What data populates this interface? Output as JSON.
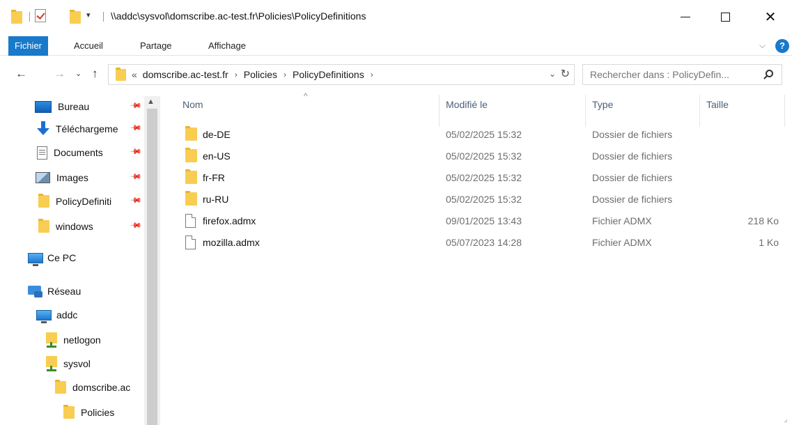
{
  "window": {
    "title_path": "\\\\addc\\sysvol\\domscribe.ac-test.fr\\Policies\\PolicyDefinitions"
  },
  "ribbon": {
    "tabs": [
      "Fichier",
      "Accueil",
      "Partage",
      "Affichage"
    ]
  },
  "address_bar": {
    "lead": "«",
    "crumbs": [
      "domscribe.ac-test.fr",
      "Policies",
      "PolicyDefinitions"
    ]
  },
  "search": {
    "placeholder": "Rechercher dans : PolicyDefin..."
  },
  "nav_pane": {
    "quick_access": [
      {
        "label": "Bureau",
        "icon": "desktop-icon"
      },
      {
        "label": "Téléchargeme",
        "icon": "download-icon"
      },
      {
        "label": "Documents",
        "icon": "documents-icon"
      },
      {
        "label": "Images",
        "icon": "images-icon"
      },
      {
        "label": "PolicyDefiniti",
        "icon": "folder-icon"
      },
      {
        "label": "windows",
        "icon": "folder-icon"
      }
    ],
    "this_pc": "Ce PC",
    "network": "Réseau",
    "tree": [
      {
        "label": "addc",
        "icon": "computer-icon"
      },
      {
        "label": "netlogon",
        "icon": "share-icon"
      },
      {
        "label": "sysvol",
        "icon": "share-icon"
      },
      {
        "label": "domscribe.ac",
        "icon": "folder-icon"
      },
      {
        "label": "Policies",
        "icon": "folder-icon"
      }
    ]
  },
  "columns": {
    "name": "Nom",
    "modified": "Modifié le",
    "type": "Type",
    "size": "Taille"
  },
  "files": [
    {
      "name": "de-DE",
      "modified": "05/02/2025 15:32",
      "type": "Dossier de fichiers",
      "size": "",
      "kind": "folder"
    },
    {
      "name": "en-US",
      "modified": "05/02/2025 15:32",
      "type": "Dossier de fichiers",
      "size": "",
      "kind": "folder"
    },
    {
      "name": "fr-FR",
      "modified": "05/02/2025 15:32",
      "type": "Dossier de fichiers",
      "size": "",
      "kind": "folder"
    },
    {
      "name": "ru-RU",
      "modified": "05/02/2025 15:32",
      "type": "Dossier de fichiers",
      "size": "",
      "kind": "folder"
    },
    {
      "name": "firefox.admx",
      "modified": "09/01/2025 13:43",
      "type": "Fichier ADMX",
      "size": "218 Ko",
      "kind": "file"
    },
    {
      "name": "mozilla.admx",
      "modified": "05/07/2023 14:28",
      "type": "Fichier ADMX",
      "size": "1 Ko",
      "kind": "file"
    }
  ]
}
